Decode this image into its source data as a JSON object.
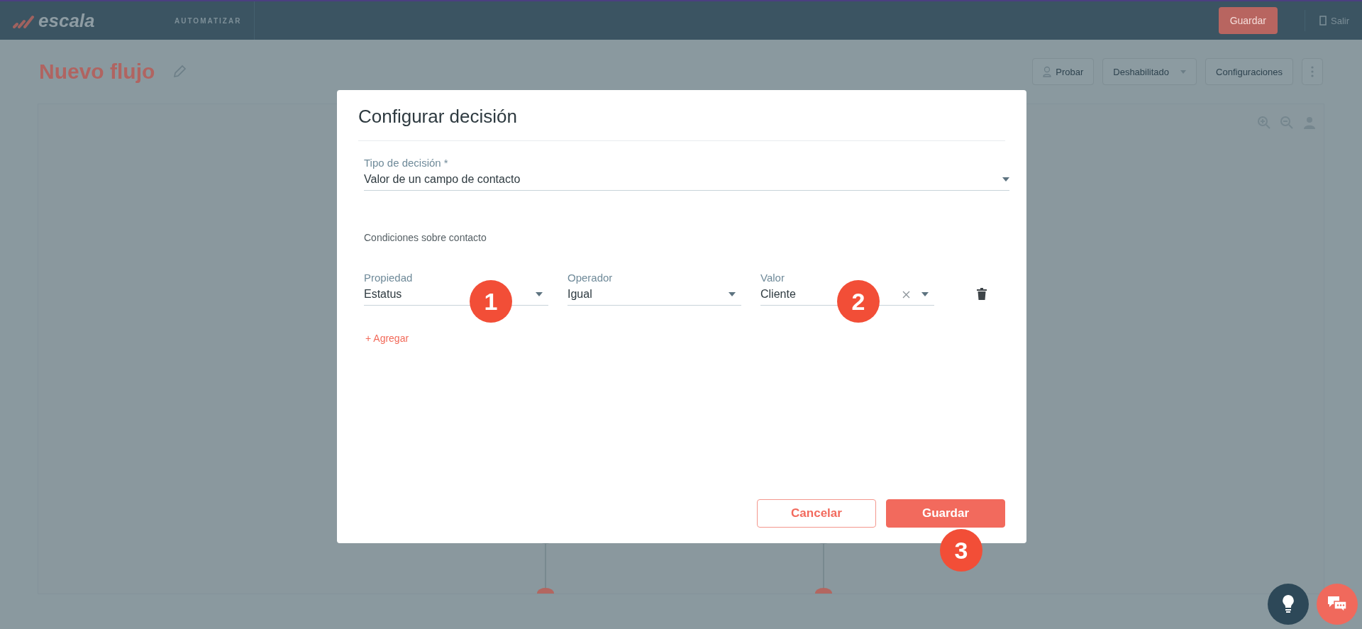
{
  "header": {
    "logo": "escala",
    "section": "AUTOMATIZAR",
    "save_button": "Guardar",
    "exit_link": "Salir"
  },
  "page": {
    "title": "Nuevo flujo",
    "actions": [
      {
        "label": "Probar",
        "kind": "person"
      },
      {
        "label": "Deshabilitado",
        "kind": "dropdown"
      },
      {
        "label": "Configuraciones",
        "kind": "plain"
      }
    ]
  },
  "dialog": {
    "title": "Configurar decisión",
    "decision_type": {
      "label": "Tipo de decisión *",
      "value": "Valor de un campo de contacto"
    },
    "conditions_title": "Condiciones sobre contacto",
    "fields": [
      {
        "label": "Propiedad",
        "value": "Estatus",
        "clearable": false
      },
      {
        "label": "Operador",
        "value": "Igual",
        "clearable": false
      },
      {
        "label": "Valor",
        "value": "Cliente",
        "clearable": true
      }
    ],
    "add_link": "+ Agregar",
    "buttons": [
      {
        "label": "Cancelar",
        "kind": "outline"
      },
      {
        "label": "Guardar",
        "kind": "primary"
      }
    ]
  },
  "annotations": [
    "1",
    "2",
    "3"
  ]
}
